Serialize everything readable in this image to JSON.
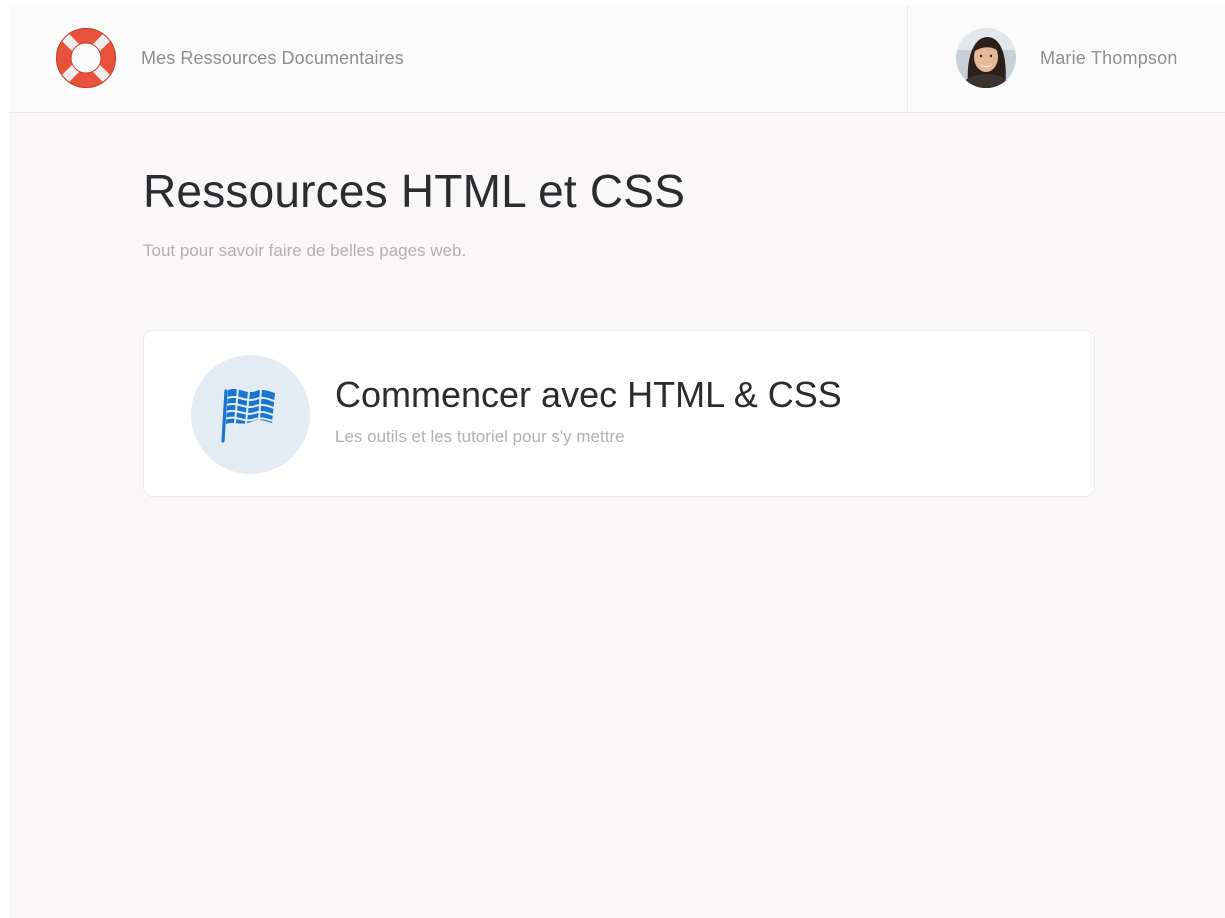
{
  "header": {
    "brand_label": "Mes Ressources Documentaires",
    "logo_icon": "lifebuoy-icon",
    "user_name": "Marie Thompson",
    "avatar_icon": "user-avatar"
  },
  "page": {
    "title": "Ressources HTML et CSS",
    "subtitle": "Tout pour savoir faire de belles pages web."
  },
  "cards": [
    {
      "icon": "checkered-flag-icon",
      "title": "Commencer avec HTML & CSS",
      "description": "Les outils et les tutoriel pour s'y mettre"
    }
  ],
  "colors": {
    "background": "#faf7f8",
    "lifebuoy_red": "#e8513b",
    "flag_blue": "#1a74d2",
    "icon_circle": "#e3ecf5",
    "title_text": "#2b2b30",
    "muted_text": "#b3b0b3"
  }
}
